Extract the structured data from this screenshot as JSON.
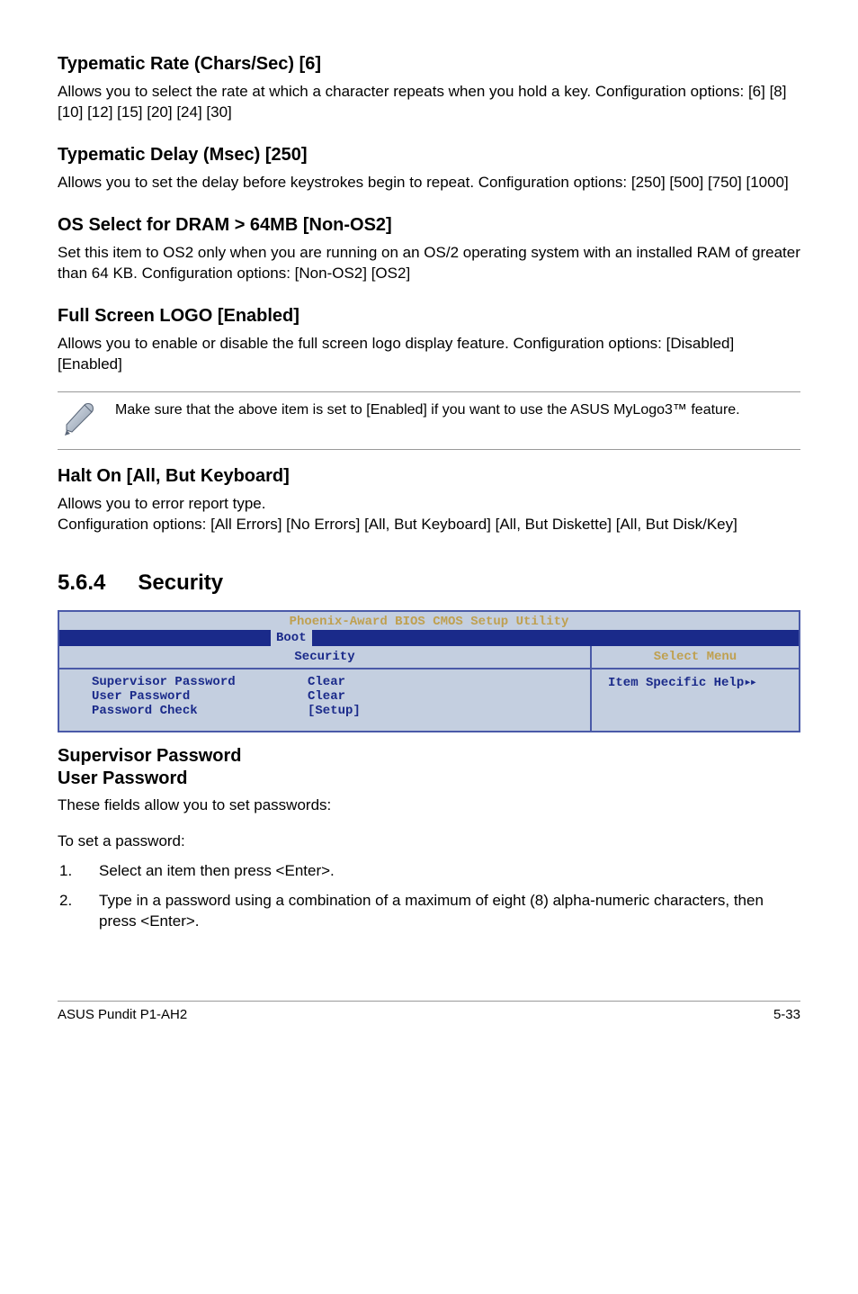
{
  "sections": {
    "typematic_rate": {
      "heading": "Typematic Rate (Chars/Sec) [6]",
      "body": "Allows you to select the rate at which a character repeats when you hold a key. Configuration options: [6] [8] [10] [12] [15] [20] [24] [30]"
    },
    "typematic_delay": {
      "heading": "Typematic Delay (Msec) [250]",
      "body": "Allows you to set the delay before keystrokes begin to repeat. Configuration options: [250] [500] [750] [1000]"
    },
    "os_select": {
      "heading": "OS Select for DRAM > 64MB [Non-OS2]",
      "body": "Set this item to OS2 only when you are running on an OS/2 operating system with an installed RAM of greater than 64 KB. Configuration options: [Non-OS2] [OS2]"
    },
    "full_screen_logo": {
      "heading": "Full Screen LOGO [Enabled]",
      "body": "Allows you to enable or disable the full screen logo display feature. Configuration options: [Disabled] [Enabled]",
      "note": "Make sure that the above item is set to [Enabled] if you want to use the ASUS MyLogo3™ feature."
    },
    "halt_on": {
      "heading": "Halt On [All, But Keyboard]",
      "line1": "Allows you to error report type.",
      "line2": "Configuration options: [All Errors] [No Errors] [All, But Keyboard] [All, But Diskette] [All, But Disk/Key]"
    }
  },
  "security_section": {
    "number": "5.6.4",
    "title": "Security"
  },
  "bios": {
    "title": "Phoenix-Award BIOS CMOS Setup Utility",
    "tab": "Boot",
    "left_header": "Security",
    "right_header": "Select Menu",
    "rows": [
      {
        "label": "Supervisor Password",
        "value": "Clear"
      },
      {
        "label": "User Password",
        "value": "Clear"
      },
      {
        "label": "Password Check",
        "value": "[Setup]"
      }
    ],
    "right_body": "Item Specific Help",
    "right_arrows": "▸▸"
  },
  "passwords": {
    "heading1": "Supervisor Password",
    "heading2": "User Password",
    "intro": "These fields allow you to set passwords:",
    "to_set": "To set a password:",
    "steps": [
      {
        "n": "1.",
        "t": "Select an item then press <Enter>."
      },
      {
        "n": "2.",
        "t": "Type in a password using a combination of a maximum of eight (8) alpha-numeric characters, then press <Enter>."
      }
    ]
  },
  "footer": {
    "left": "ASUS Pundit P1-AH2",
    "right": "5-33"
  }
}
